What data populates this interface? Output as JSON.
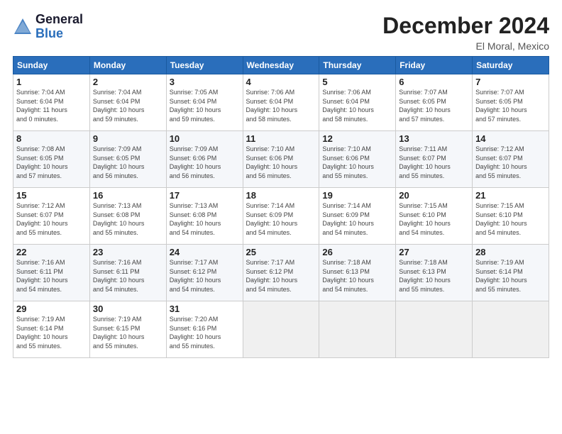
{
  "header": {
    "logo_line1": "General",
    "logo_line2": "Blue",
    "month": "December 2024",
    "location": "El Moral, Mexico"
  },
  "days_of_week": [
    "Sunday",
    "Monday",
    "Tuesday",
    "Wednesday",
    "Thursday",
    "Friday",
    "Saturday"
  ],
  "weeks": [
    [
      {
        "day": "1",
        "info": "Sunrise: 7:04 AM\nSunset: 6:04 PM\nDaylight: 11 hours\nand 0 minutes."
      },
      {
        "day": "2",
        "info": "Sunrise: 7:04 AM\nSunset: 6:04 PM\nDaylight: 10 hours\nand 59 minutes."
      },
      {
        "day": "3",
        "info": "Sunrise: 7:05 AM\nSunset: 6:04 PM\nDaylight: 10 hours\nand 59 minutes."
      },
      {
        "day": "4",
        "info": "Sunrise: 7:06 AM\nSunset: 6:04 PM\nDaylight: 10 hours\nand 58 minutes."
      },
      {
        "day": "5",
        "info": "Sunrise: 7:06 AM\nSunset: 6:04 PM\nDaylight: 10 hours\nand 58 minutes."
      },
      {
        "day": "6",
        "info": "Sunrise: 7:07 AM\nSunset: 6:05 PM\nDaylight: 10 hours\nand 57 minutes."
      },
      {
        "day": "7",
        "info": "Sunrise: 7:07 AM\nSunset: 6:05 PM\nDaylight: 10 hours\nand 57 minutes."
      }
    ],
    [
      {
        "day": "8",
        "info": "Sunrise: 7:08 AM\nSunset: 6:05 PM\nDaylight: 10 hours\nand 57 minutes."
      },
      {
        "day": "9",
        "info": "Sunrise: 7:09 AM\nSunset: 6:05 PM\nDaylight: 10 hours\nand 56 minutes."
      },
      {
        "day": "10",
        "info": "Sunrise: 7:09 AM\nSunset: 6:06 PM\nDaylight: 10 hours\nand 56 minutes."
      },
      {
        "day": "11",
        "info": "Sunrise: 7:10 AM\nSunset: 6:06 PM\nDaylight: 10 hours\nand 56 minutes."
      },
      {
        "day": "12",
        "info": "Sunrise: 7:10 AM\nSunset: 6:06 PM\nDaylight: 10 hours\nand 55 minutes."
      },
      {
        "day": "13",
        "info": "Sunrise: 7:11 AM\nSunset: 6:07 PM\nDaylight: 10 hours\nand 55 minutes."
      },
      {
        "day": "14",
        "info": "Sunrise: 7:12 AM\nSunset: 6:07 PM\nDaylight: 10 hours\nand 55 minutes."
      }
    ],
    [
      {
        "day": "15",
        "info": "Sunrise: 7:12 AM\nSunset: 6:07 PM\nDaylight: 10 hours\nand 55 minutes."
      },
      {
        "day": "16",
        "info": "Sunrise: 7:13 AM\nSunset: 6:08 PM\nDaylight: 10 hours\nand 55 minutes."
      },
      {
        "day": "17",
        "info": "Sunrise: 7:13 AM\nSunset: 6:08 PM\nDaylight: 10 hours\nand 54 minutes."
      },
      {
        "day": "18",
        "info": "Sunrise: 7:14 AM\nSunset: 6:09 PM\nDaylight: 10 hours\nand 54 minutes."
      },
      {
        "day": "19",
        "info": "Sunrise: 7:14 AM\nSunset: 6:09 PM\nDaylight: 10 hours\nand 54 minutes."
      },
      {
        "day": "20",
        "info": "Sunrise: 7:15 AM\nSunset: 6:10 PM\nDaylight: 10 hours\nand 54 minutes."
      },
      {
        "day": "21",
        "info": "Sunrise: 7:15 AM\nSunset: 6:10 PM\nDaylight: 10 hours\nand 54 minutes."
      }
    ],
    [
      {
        "day": "22",
        "info": "Sunrise: 7:16 AM\nSunset: 6:11 PM\nDaylight: 10 hours\nand 54 minutes."
      },
      {
        "day": "23",
        "info": "Sunrise: 7:16 AM\nSunset: 6:11 PM\nDaylight: 10 hours\nand 54 minutes."
      },
      {
        "day": "24",
        "info": "Sunrise: 7:17 AM\nSunset: 6:12 PM\nDaylight: 10 hours\nand 54 minutes."
      },
      {
        "day": "25",
        "info": "Sunrise: 7:17 AM\nSunset: 6:12 PM\nDaylight: 10 hours\nand 54 minutes."
      },
      {
        "day": "26",
        "info": "Sunrise: 7:18 AM\nSunset: 6:13 PM\nDaylight: 10 hours\nand 54 minutes."
      },
      {
        "day": "27",
        "info": "Sunrise: 7:18 AM\nSunset: 6:13 PM\nDaylight: 10 hours\nand 55 minutes."
      },
      {
        "day": "28",
        "info": "Sunrise: 7:19 AM\nSunset: 6:14 PM\nDaylight: 10 hours\nand 55 minutes."
      }
    ],
    [
      {
        "day": "29",
        "info": "Sunrise: 7:19 AM\nSunset: 6:14 PM\nDaylight: 10 hours\nand 55 minutes."
      },
      {
        "day": "30",
        "info": "Sunrise: 7:19 AM\nSunset: 6:15 PM\nDaylight: 10 hours\nand 55 minutes."
      },
      {
        "day": "31",
        "info": "Sunrise: 7:20 AM\nSunset: 6:16 PM\nDaylight: 10 hours\nand 55 minutes."
      },
      {
        "day": "",
        "info": ""
      },
      {
        "day": "",
        "info": ""
      },
      {
        "day": "",
        "info": ""
      },
      {
        "day": "",
        "info": ""
      }
    ]
  ]
}
